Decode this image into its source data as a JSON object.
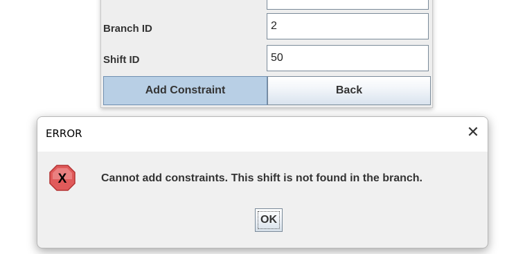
{
  "form": {
    "fields": [
      {
        "label": "Branch ID",
        "value": "2"
      },
      {
        "label": "Shift ID",
        "value": "50"
      }
    ],
    "add_label": "Add Constraint",
    "back_label": "Back"
  },
  "dialog": {
    "title": "ERROR",
    "close_glyph": "✕",
    "message": "Cannot add constraints. This shift is not found in the branch.",
    "ok_label": "OK",
    "icon": "error-x-icon"
  },
  "colors": {
    "primary_button": "#b8cfe5",
    "error_icon": "#e05a5a",
    "dialog_background": "#f0f0f0"
  }
}
